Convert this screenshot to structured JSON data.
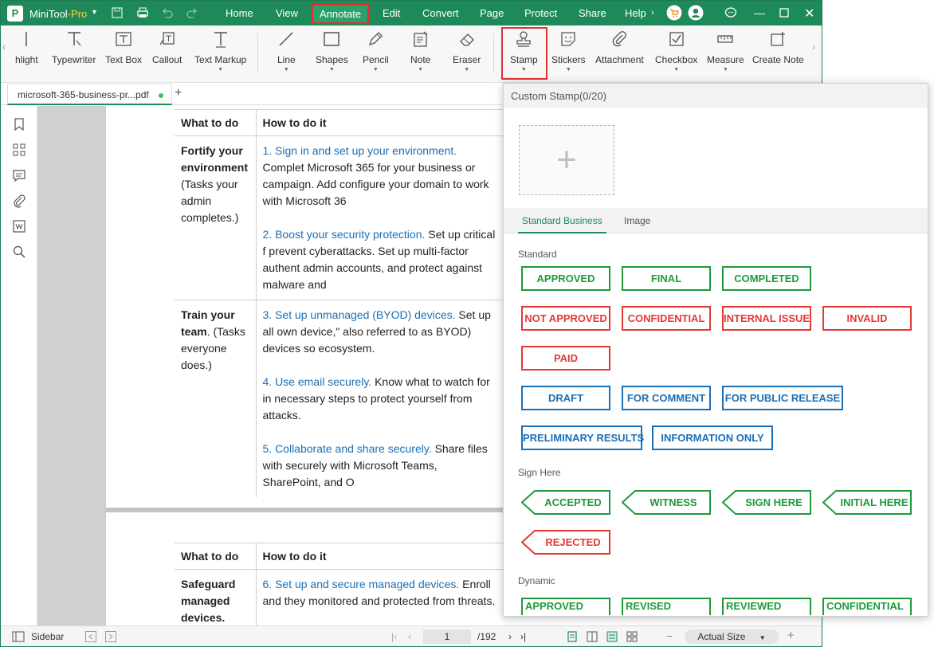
{
  "titlebar": {
    "app_name": "MiniTool",
    "app_suffix": "-Pro",
    "menus": [
      "Home",
      "View",
      "Annotate",
      "Edit",
      "Convert",
      "Page",
      "Protect",
      "Share",
      "Help"
    ],
    "active_menu": "Annotate"
  },
  "ribbon": {
    "tools": [
      "hlight",
      "Typewriter",
      "Text Box",
      "Callout",
      "Text Markup",
      "Line",
      "Shapes",
      "Pencil",
      "Note",
      "Eraser",
      "Stamp",
      "Stickers",
      "Attachment",
      "Checkbox",
      "Measure",
      "Create Note"
    ]
  },
  "tab": {
    "filename": "microsoft-365-business-pr...pdf"
  },
  "document": {
    "table1": {
      "headers": [
        "What to do",
        "How to do it"
      ],
      "rows": [
        {
          "what_bold": "Fortify your environment",
          "what_rest": "(Tasks your admin completes.)",
          "items": [
            {
              "link": "1. Sign in and set up your environment.",
              "text": " Complet Microsoft 365 for your business or campaign. Add configure your domain to work with Microsoft 36"
            },
            {
              "link": "2. Boost your security protection.",
              "text": " Set up critical f prevent cyberattacks. Set up multi-factor authent admin accounts, and protect against malware and"
            }
          ]
        },
        {
          "what_bold": "Train your team",
          "what_rest": ". (Tasks everyone does.)",
          "items": [
            {
              "link": "3. Set up unmanaged (BYOD) devices.",
              "text": " Set up all own device,\" also referred to as BYOD) devices so ecosystem."
            },
            {
              "link": "4. Use email securely.",
              "text": " Know what to watch for in necessary steps to protect yourself from attacks."
            },
            {
              "link": "5. Collaborate and share securely.",
              "text": " Share files with securely with Microsoft Teams, SharePoint, and O"
            }
          ]
        }
      ]
    },
    "table2": {
      "headers": [
        "What to do",
        "How to do it"
      ],
      "rows": [
        {
          "what_bold": "Safeguard managed devices.",
          "items": [
            {
              "link": "6. Set up and secure managed devices.",
              "text": " Enroll and they monitored and protected from threats."
            }
          ]
        }
      ]
    }
  },
  "statusbar": {
    "sidebar_label": "Sidebar",
    "current_page": "1",
    "total_pages": "/192",
    "zoom": "Actual Size"
  },
  "stamp_panel": {
    "header": "Custom Stamp(0/20)",
    "tabs": [
      "Standard Business",
      "Image"
    ],
    "sections": {
      "standard": "Standard",
      "sign_here": "Sign Here",
      "dynamic": "Dynamic"
    },
    "standard_stamps": [
      {
        "label": "APPROVED",
        "color": "#1e9a3a"
      },
      {
        "label": "FINAL",
        "color": "#1e9a3a"
      },
      {
        "label": "COMPLETED",
        "color": "#1e9a3a"
      },
      {
        "label": "NOT APPROVED",
        "color": "#e53935"
      },
      {
        "label": "CONFIDENTIAL",
        "color": "#e53935"
      },
      {
        "label": "INTERNAL ISSUE",
        "color": "#e53935"
      },
      {
        "label": "INVALID",
        "color": "#e53935"
      },
      {
        "label": "PAID",
        "color": "#e53935"
      },
      {
        "label": "DRAFT",
        "color": "#1a6fb5"
      },
      {
        "label": "FOR COMMENT",
        "color": "#1a6fb5"
      },
      {
        "label": "FOR PUBLIC RELEASE",
        "color": "#1a6fb5"
      },
      {
        "label": "PRELIMINARY RESULTS",
        "color": "#1a6fb5"
      },
      {
        "label": "INFORMATION ONLY",
        "color": "#1a6fb5"
      }
    ],
    "sign_stamps": [
      {
        "label": "ACCEPTED",
        "color": "#1e9a3a"
      },
      {
        "label": "WITNESS",
        "color": "#1e9a3a"
      },
      {
        "label": "SIGN HERE",
        "color": "#1e9a3a"
      },
      {
        "label": "INITIAL HERE",
        "color": "#1e9a3a"
      },
      {
        "label": "REJECTED",
        "color": "#e53935"
      }
    ],
    "dynamic_stamps": [
      {
        "label": "APPROVED",
        "color": "#1e9a3a"
      },
      {
        "label": "REVISED",
        "color": "#1e9a3a"
      },
      {
        "label": "REVIEWED",
        "color": "#1e9a3a"
      },
      {
        "label": "CONFIDENTIAL",
        "color": "#1e9a3a"
      }
    ]
  }
}
